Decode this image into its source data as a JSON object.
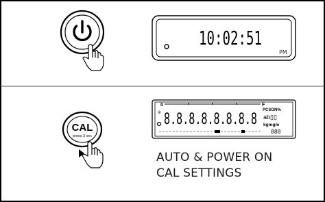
{
  "power_section": {
    "button_icon": "power-icon",
    "display_time": "10:02:51",
    "display_unit": "PM"
  },
  "cal_section": {
    "button_label": "CAL",
    "button_sublabel": "press 3 sec",
    "segment_digits": "8.8.8.8.8.8.8.8",
    "lcd_scale_left": "0",
    "lcd_scale_right": "F",
    "lcd_status_left": "PCSGN%",
    "lcd_units": "kgmgm",
    "caption_line1": "AUTO &  POWER ON",
    "caption_line2": "CAL SETTINGS"
  }
}
